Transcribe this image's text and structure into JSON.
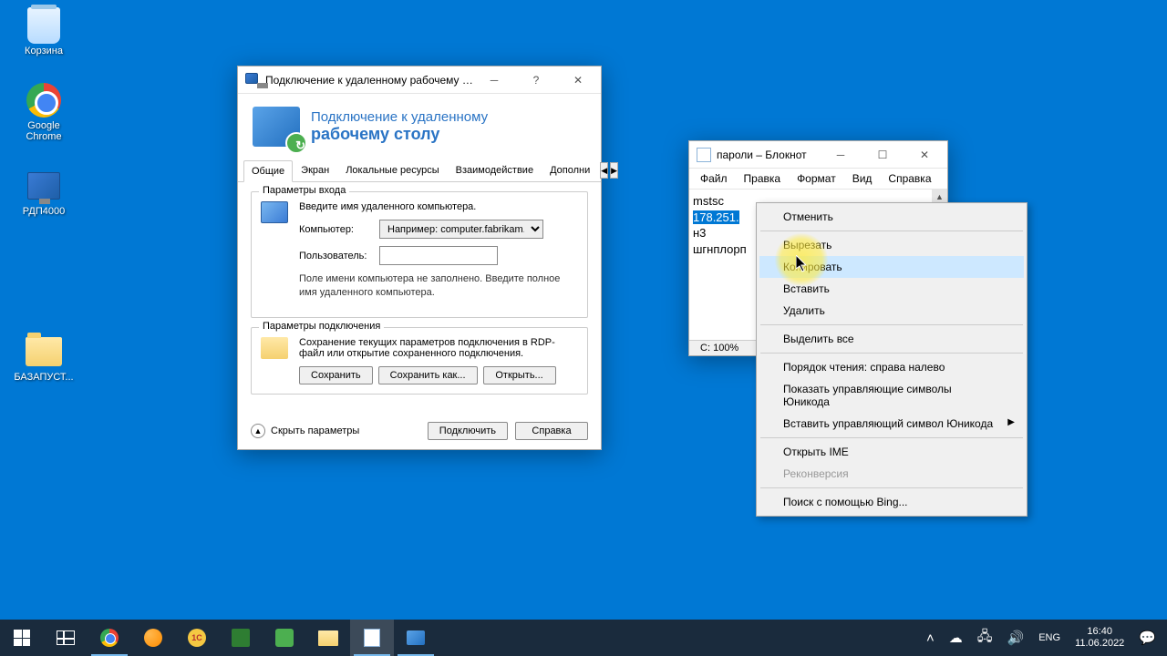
{
  "desktop_icons": {
    "recycle": "Корзина",
    "chrome": "Google Chrome",
    "rdp4000": "РДП4000",
    "folder": "БАЗАПУСТ..."
  },
  "rdp": {
    "title": "Подключение к удаленному рабочему с...",
    "header_line1": "Подключение к удаленному",
    "header_line2": "рабочему столу",
    "tabs": {
      "general": "Общие",
      "screen": "Экран",
      "local": "Локальные ресурсы",
      "interaction": "Взаимодействие",
      "additional": "Дополни"
    },
    "group_login": {
      "legend": "Параметры входа",
      "instruction": "Введите имя удаленного компьютера.",
      "computer_label": "Компьютер:",
      "computer_placeholder": "Например: computer.fabrikam.com",
      "user_label": "Пользователь:",
      "note": "Поле имени компьютера не заполнено. Введите полное имя удаленного компьютера."
    },
    "group_conn": {
      "legend": "Параметры подключения",
      "text": "Сохранение текущих параметров подключения в RDP-файл или открытие сохраненного подключения.",
      "save": "Сохранить",
      "save_as": "Сохранить как...",
      "open": "Открыть..."
    },
    "footer": {
      "hide": "Скрыть параметры",
      "connect": "Подключить",
      "help": "Справка"
    }
  },
  "notepad": {
    "title": "пароли – Блокнот",
    "menu": {
      "file": "Файл",
      "edit": "Правка",
      "format": "Формат",
      "view": "Вид",
      "help": "Справка"
    },
    "lines": {
      "l1": "mstsc",
      "l2_sel": "178.251.",
      "l3": "н3",
      "l4": "шгнплорп"
    },
    "status": {
      "col": "С",
      "zoom": "100%"
    }
  },
  "context_menu": {
    "undo": "Отменить",
    "cut": "Вырезать",
    "copy": "Копировать",
    "paste": "Вставить",
    "delete": "Удалить",
    "select_all": "Выделить все",
    "rtl": "Порядок чтения: справа налево",
    "show_unicode": "Показать управляющие символы Юникода",
    "insert_unicode": "Вставить управляющий символ Юникода",
    "open_ime": "Открыть IME",
    "reconvert": "Реконверсия",
    "bing": "Поиск с помощью Bing..."
  },
  "taskbar": {
    "lang": "ENG",
    "time": "16:40",
    "date": "11.06.2022"
  }
}
